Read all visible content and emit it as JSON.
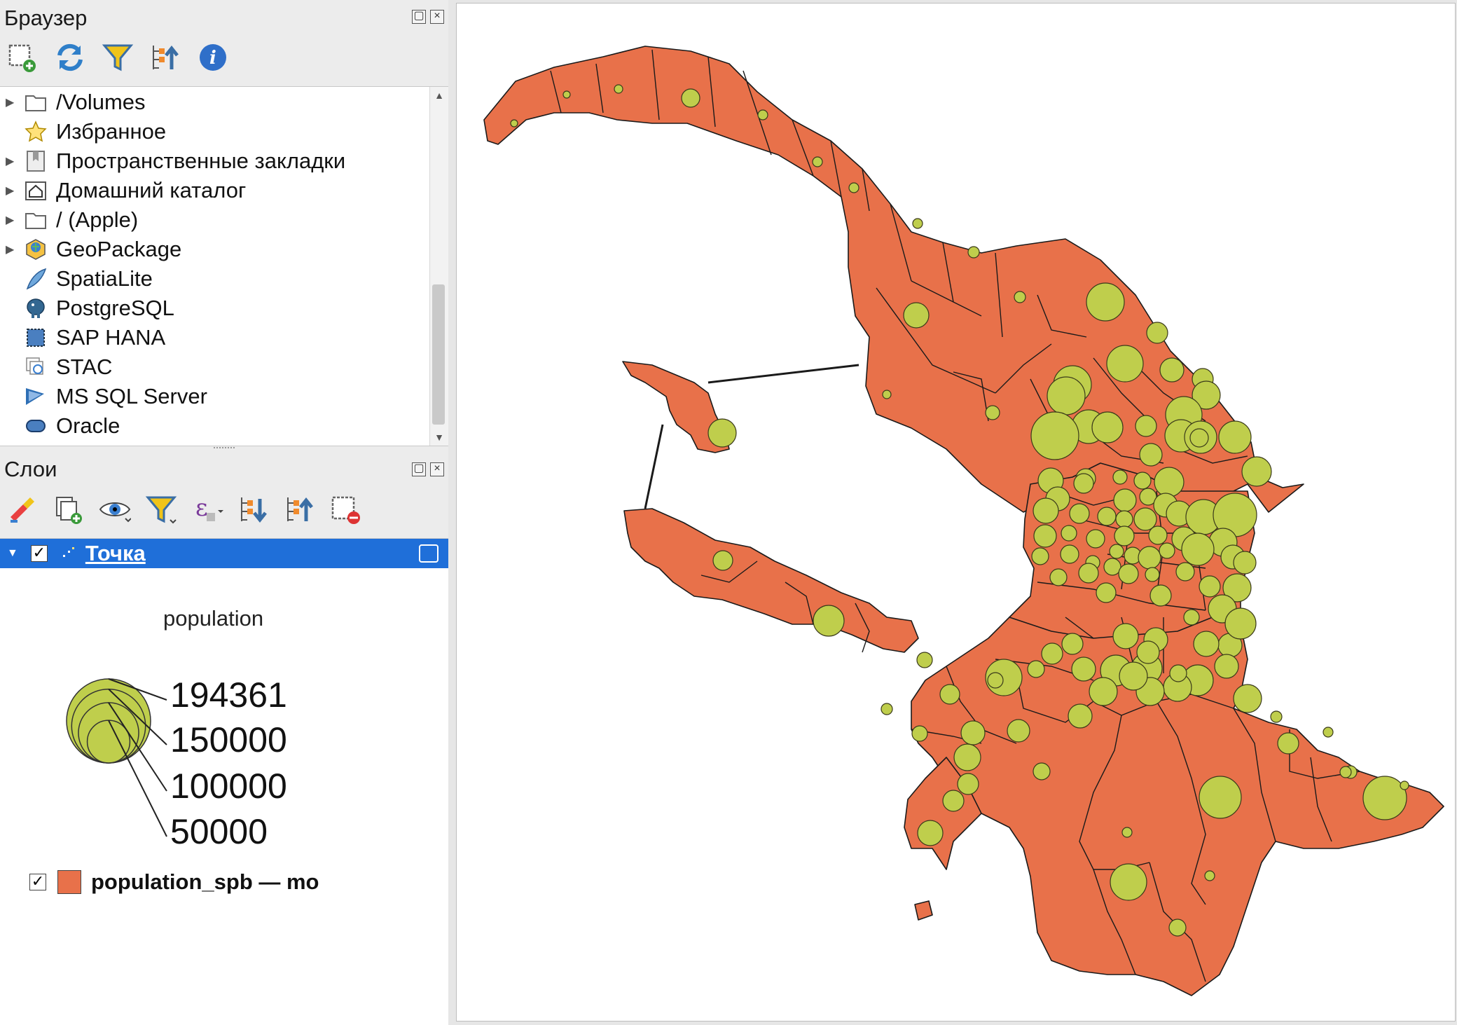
{
  "browser_panel": {
    "title": "Браузер",
    "toolbar": [
      "add-layer-icon",
      "refresh-icon",
      "filter-icon",
      "collapse-all-icon",
      "info-icon"
    ],
    "items": [
      {
        "label": "/Volumes",
        "icon": "folder-icon",
        "expandable": true
      },
      {
        "label": "Избранное",
        "icon": "star-icon",
        "expandable": false
      },
      {
        "label": "Пространственные закладки",
        "icon": "bookmark-icon",
        "expandable": true
      },
      {
        "label": "Домашний каталог",
        "icon": "home-icon",
        "expandable": true
      },
      {
        "label": "/ (Apple)",
        "icon": "folder-icon",
        "expandable": true
      },
      {
        "label": "GeoPackage",
        "icon": "geopackage-icon",
        "expandable": true
      },
      {
        "label": "SpatiaLite",
        "icon": "feather-icon",
        "expandable": false
      },
      {
        "label": "PostgreSQL",
        "icon": "elephant-icon",
        "expandable": false
      },
      {
        "label": "SAP HANA",
        "icon": "sap-hana-icon",
        "expandable": false
      },
      {
        "label": "STAC",
        "icon": "stac-icon",
        "expandable": false
      },
      {
        "label": "MS SQL Server",
        "icon": "mssql-icon",
        "expandable": false
      },
      {
        "label": "Oracle",
        "icon": "oracle-icon",
        "expandable": false
      }
    ]
  },
  "layers_panel": {
    "title": "Слои",
    "toolbar": [
      "style-icon",
      "add-group-icon",
      "visibility-icon",
      "filter-icon",
      "expression-filter-icon",
      "expand-all-icon",
      "collapse-all-icon",
      "remove-layer-icon"
    ],
    "layers": [
      {
        "name": "Точка",
        "checked": true,
        "selected": true
      },
      {
        "name": "population_spb — mo",
        "checked": true,
        "selected": false,
        "color": "#e8714a"
      }
    ],
    "legend": {
      "field": "population",
      "labels": [
        "194361",
        "150000",
        "100000",
        "50000"
      ],
      "values": [
        194361,
        150000,
        100000,
        50000
      ],
      "fill": "#bfce4c"
    }
  },
  "map": {
    "polygon_color": "#e8714a",
    "symbol_color": "#bfce4c",
    "border_color": "#1a1a1a"
  }
}
